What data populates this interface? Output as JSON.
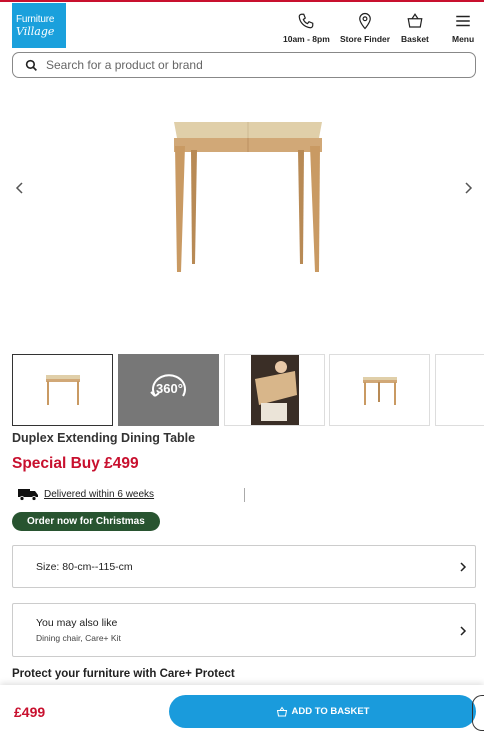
{
  "header": {
    "logo_line1": "Furniture",
    "logo_line2": "Village",
    "nav": [
      {
        "label": "10am - 8pm",
        "icon": "phone-icon"
      },
      {
        "label": "Store Finder",
        "icon": "map-pin-icon"
      },
      {
        "label": "Basket",
        "icon": "basket-icon"
      },
      {
        "label": "Menu",
        "icon": "hamburger-menu-icon"
      }
    ]
  },
  "search": {
    "placeholder": "Search for a product or brand",
    "value": ""
  },
  "gallery": {
    "thumbnails": [
      {
        "kind": "product-front",
        "active": true
      },
      {
        "kind": "360-view",
        "label": "360°"
      },
      {
        "kind": "lifestyle"
      },
      {
        "kind": "product-side"
      },
      {
        "kind": "product-partial"
      }
    ]
  },
  "product": {
    "title": "Duplex Extending Dining Table",
    "price_label": "Special Buy £499",
    "delivery": "Delivered within 6 weeks",
    "badge": "Order now for Christmas",
    "size_label": "Size: 80-cm--115-cm",
    "also_like_title": "You may also like",
    "also_like_sub": "Dining chair, Care+ Kit",
    "protect": "Protect your furniture with Care+ Protect"
  },
  "bottom_bar": {
    "price": "£499",
    "add_button": "ADD TO BASKET"
  },
  "colors": {
    "brand_red": "#c8102e",
    "brand_blue": "#1aa0dc",
    "badge_green": "#285430"
  }
}
